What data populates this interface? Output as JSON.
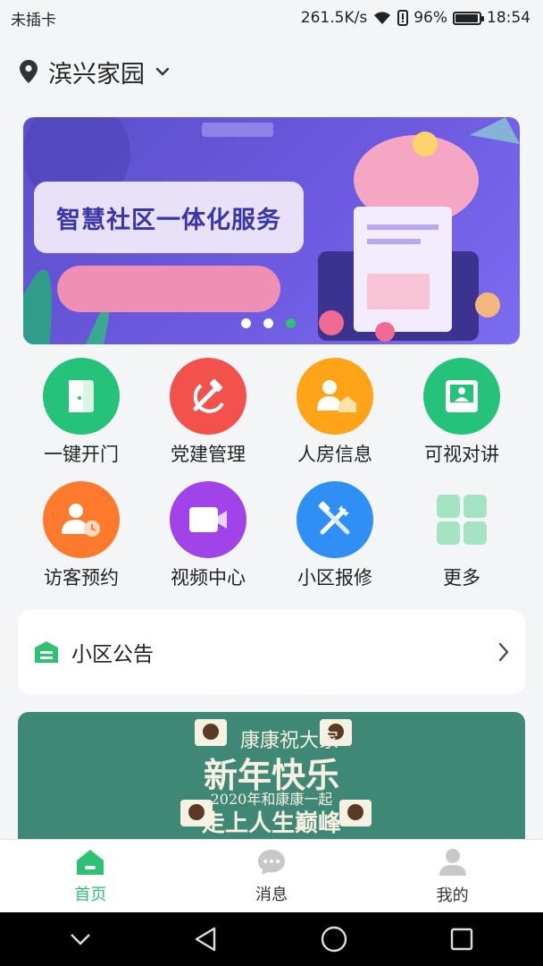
{
  "status_bar": {
    "carrier": "未插卡",
    "speed": "261.5K/s",
    "battery": "96%",
    "time": "18:54"
  },
  "location": {
    "name": "滨兴家园"
  },
  "banner": {
    "title": "智慧社区一体化服务",
    "active_dot": 2,
    "dot_count": 3
  },
  "menu": {
    "items": [
      {
        "label": "一键开门",
        "icon": "door-icon",
        "color": "#25c27a"
      },
      {
        "label": "党建管理",
        "icon": "hammer-sickle-icon",
        "color": "#f2514c"
      },
      {
        "label": "人房信息",
        "icon": "person-house-icon",
        "color": "#ffa418"
      },
      {
        "label": "可视对讲",
        "icon": "video-intercom-icon",
        "color": "#25c27a"
      },
      {
        "label": "访客预约",
        "icon": "visitor-clock-icon",
        "color": "#ff7a2c"
      },
      {
        "label": "视频中心",
        "icon": "video-camera-icon",
        "color": "#a043e8"
      },
      {
        "label": "小区报修",
        "icon": "repair-tools-icon",
        "color": "#2f8ff5"
      },
      {
        "label": "更多",
        "icon": "grid-more-icon",
        "color": "#a4e3c4"
      }
    ]
  },
  "notice": {
    "title": "小区公告"
  },
  "news": {
    "line1": "康康祝大家",
    "line2": "新年快乐",
    "line3": "2020年和康康一起",
    "line4": "走上人生巅峰"
  },
  "tabs": [
    {
      "label": "首页",
      "icon": "home-icon",
      "active": true
    },
    {
      "label": "消息",
      "icon": "message-icon",
      "active": false
    },
    {
      "label": "我的",
      "icon": "user-icon",
      "active": false
    }
  ],
  "colors": {
    "accent": "#2ec174",
    "banner": "#6d5ae0",
    "news_bg": "#3f8875"
  }
}
